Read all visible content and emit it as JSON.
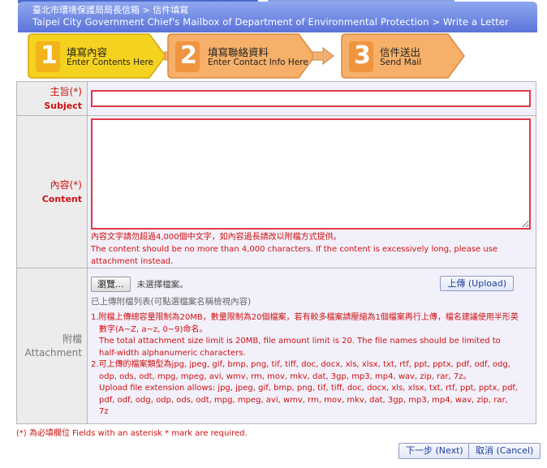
{
  "header": {
    "breadcrumb_zh": "臺北市環境保護局局長信箱 > 信件填寫",
    "breadcrumb_en": "Taipei City Government Chief's Mailbox of Department of Environmental Protection > Write a Letter"
  },
  "steps": [
    {
      "number": "1",
      "title": "填寫內容",
      "subtitle": "Enter Contents Here",
      "active": true
    },
    {
      "number": "2",
      "title": "填寫聯絡資料",
      "subtitle": "Enter Contact Info Here",
      "active": false
    },
    {
      "number": "3",
      "title": "信件送出",
      "subtitle": "Send Mail",
      "active": false
    }
  ],
  "form": {
    "subject": {
      "label_zh": "主旨(*)",
      "label_en": "Subject",
      "value": ""
    },
    "content": {
      "label_zh": "內容(*)",
      "label_en": "Content",
      "value": "",
      "note_zh": "內容文字請勿超過4,000個中文字，如內容過長請改以附檔方式提供。",
      "note_en": "The content should be no more than 4,000 characters. If the content is excessively long, please use attachment instead."
    },
    "attachment": {
      "label_zh": "附檔",
      "label_en": "Attachment",
      "browse_label": "瀏覽...",
      "no_file_text": "未選擇檔案。",
      "upload_label": "上傳 (Upload)",
      "list_label": "已上傳附檔列表(可點選檔案名稱檢視內容)",
      "note1_zh": "1.附檔上傳總容量限制為20MB，數量限制為20個檔案，若有較多檔案請壓縮為1個檔案再行上傳，檔名建議使用半形英數字(A~Z, a~z, 0~9)命名。",
      "note1_en": "The total attachment size limit is 20MB, file amount limit is 20. The file names should be limited to half-width alphanumeric characters.",
      "note2_zh": "2.可上傳的檔案類型為jpg, jpeg, gif, bmp, png, tif, tiff, doc, docx, xls, xlsx, txt, rtf, ppt, pptx, pdf, odf, odg, odp, ods, odt, mpg, mpeg, avi, wmv, rm, mov, mkv, dat, 3gp, mp3, mp4, wav, zip, rar, 7z。",
      "note2_en": "Upload file extension allows: jpg, jpeg, gif, bmp, png, tif, tiff, doc, docx, xls, xlsx, txt, rtf, ppt, pptx, pdf, pdf, odf, odg, odp, ods, odt, mpg, mpeg, avi, wmv, rm, mov, mkv, dat, 3gp, mp3, mp4, wav, zip, rar, 7z"
    },
    "required_note": "(*) 為必填欄位 Fields with an asterisk * mark are required."
  },
  "buttons": {
    "next": "下一步 (Next)",
    "cancel": "取消 (Cancel)"
  },
  "colors": {
    "header_blue": "#5b74d9",
    "active_step": "#f5d21f",
    "inactive_step": "#f6b06a",
    "required_red": "#d01010",
    "link_blue": "#1c3f9a"
  }
}
